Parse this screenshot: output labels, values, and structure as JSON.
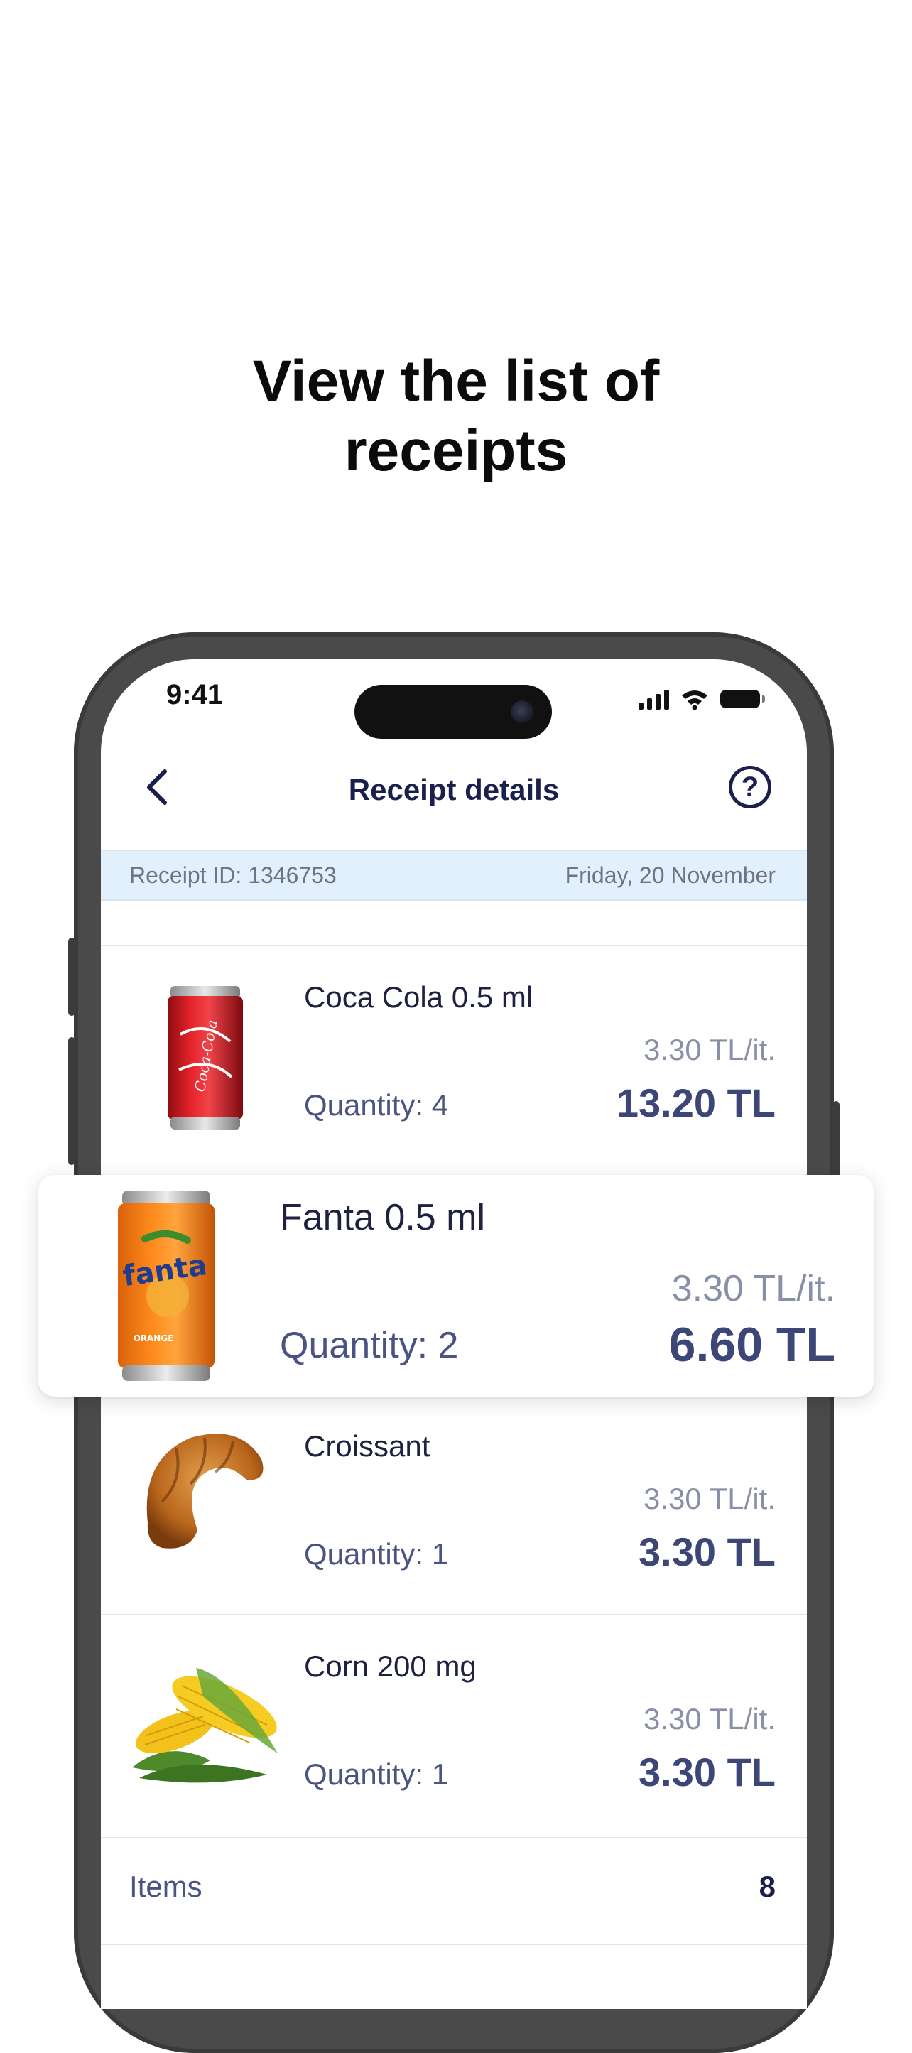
{
  "headline": {
    "line1": "View the list of",
    "line2": "receipts"
  },
  "status_bar": {
    "time": "9:41",
    "icons": [
      "signal-icon",
      "wifi-icon",
      "battery-icon"
    ]
  },
  "header": {
    "title": "Receipt details",
    "back_icon": "chevron-left-icon",
    "help_icon": "question-circle-icon",
    "help_glyph": "?"
  },
  "receipt": {
    "id_text": "Receipt ID: 1346753",
    "date": "Friday, 20 November"
  },
  "items": [
    {
      "name": "Coca Cola 0.5 ml",
      "quantity": "Quantity: 4",
      "unit_price": "3.30 TL/it.",
      "total": "13.20 TL",
      "image": "coca-cola-can"
    },
    {
      "name": "Fanta 0.5 ml",
      "quantity": "Quantity: 2",
      "unit_price": "3.30 TL/it.",
      "total": "6.60 TL",
      "image": "fanta-can",
      "highlighted": true
    },
    {
      "name": "Croissant",
      "quantity": "Quantity: 1",
      "unit_price": "3.30 TL/it.",
      "total": "3.30 TL",
      "image": "croissant"
    },
    {
      "name": "Corn 200 mg",
      "quantity": "Quantity: 1",
      "unit_price": "3.30 TL/it.",
      "total": "3.30 TL",
      "image": "corn"
    }
  ],
  "summary": {
    "items_label": "Items",
    "items_value": "8"
  },
  "colors": {
    "accent_navy": "#1b1f4b",
    "price_navy": "#3c4677",
    "info_bar_bg": "#e2f0fb",
    "muted_text": "#8a8fa8"
  }
}
